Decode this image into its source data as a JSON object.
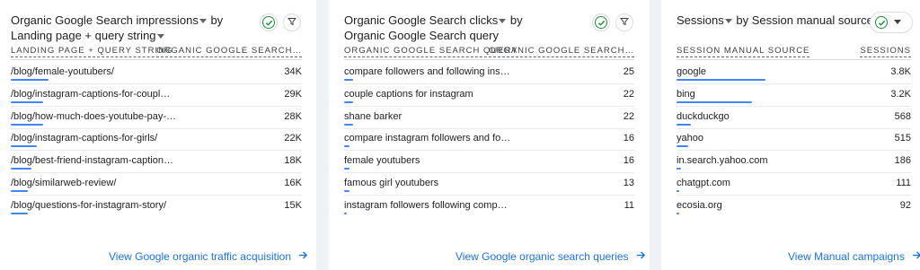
{
  "cards": [
    {
      "title_line1": "Organic Google Search impressions",
      "title_by": " by",
      "title_line2": "Landing page + query string",
      "col1": "LANDING PAGE + QUERY STRING",
      "col2": "ORGANIC GOOGLE SEARCH…",
      "rows": [
        {
          "label": "/blog/female-youtubers/",
          "value": "34K",
          "share": 0.13
        },
        {
          "label": "/blog/instagram-captions-for-coupl…",
          "value": "29K",
          "share": 0.11
        },
        {
          "label": "/blog/how-much-does-youtube-pay-…",
          "value": "28K",
          "share": 0.11
        },
        {
          "label": "/blog/instagram-captions-for-girls/",
          "value": "22K",
          "share": 0.09
        },
        {
          "label": "/blog/best-friend-instagram-caption…",
          "value": "18K",
          "share": 0.07
        },
        {
          "label": "/blog/similarweb-review/",
          "value": "16K",
          "share": 0.06
        },
        {
          "label": "/blog/questions-for-instagram-story/",
          "value": "15K",
          "share": 0.06
        }
      ],
      "link": "View Google organic traffic acquisition"
    },
    {
      "title_line1": "Organic Google Search clicks",
      "title_by": " by",
      "title_line2": "Organic Google Search query",
      "col1": "ORGANIC GOOGLE SEARCH QUERY",
      "col2": "ORGANIC GOOGLE SEARCH…",
      "rows": [
        {
          "label": "compare followers and following ins…",
          "value": "25",
          "share": 0.03
        },
        {
          "label": "couple captions for instagram",
          "value": "22",
          "share": 0.03
        },
        {
          "label": "shane barker",
          "value": "22",
          "share": 0.03
        },
        {
          "label": "compare instagram followers and fo…",
          "value": "16",
          "share": 0.02
        },
        {
          "label": "female youtubers",
          "value": "16",
          "share": 0.02
        },
        {
          "label": "famous girl youtubers",
          "value": "13",
          "share": 0.02
        },
        {
          "label": "instagram followers following comp…",
          "value": "11",
          "share": 0.01
        }
      ],
      "link": "View Google organic search queries"
    },
    {
      "title_line1": "Sessions",
      "title_by": " by Session manual source",
      "title_line2": "",
      "col1": "SESSION MANUAL SOURCE",
      "col2": "SESSIONS",
      "rows": [
        {
          "label": "google",
          "value": "3.8K",
          "share": 0.38
        },
        {
          "label": "bing",
          "value": "3.2K",
          "share": 0.32
        },
        {
          "label": "duckduckgo",
          "value": "568",
          "share": 0.06
        },
        {
          "label": "yahoo",
          "value": "515",
          "share": 0.05
        },
        {
          "label": "in.search.yahoo.com",
          "value": "186",
          "share": 0.02
        },
        {
          "label": "chatgpt.com",
          "value": "111",
          "share": 0.01
        },
        {
          "label": "ecosia.org",
          "value": "92",
          "share": 0.01
        }
      ],
      "link": "View Manual campaigns"
    }
  ],
  "icons": {
    "check": "check-circle-icon",
    "filter": "filter-icon",
    "dropdown": "dropdown-triangle-icon",
    "arrow": "arrow-right-icon"
  },
  "colors": {
    "accent": "#1a73e8",
    "bar": "#4285f4",
    "check": "#1e8e3e"
  }
}
